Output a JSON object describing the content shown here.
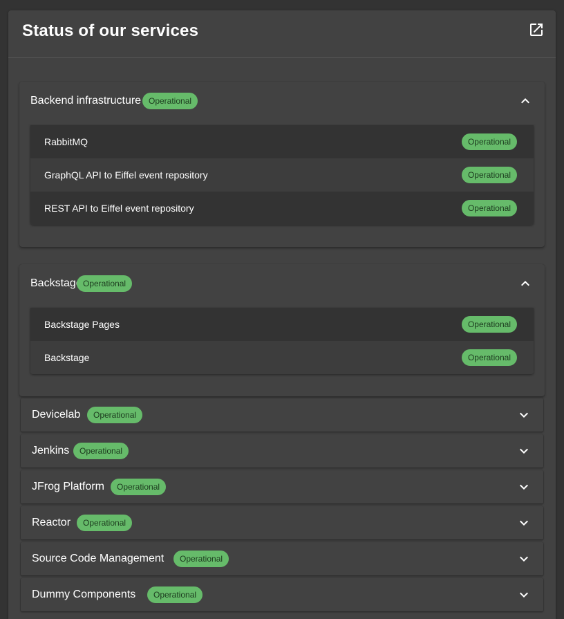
{
  "card": {
    "title": "Status of our services",
    "open_icon": "open-in-new-icon"
  },
  "status_color": "#66bb6a",
  "expanded_groups": [
    {
      "name": "Backend infrastructure",
      "status": "Operational",
      "services": [
        {
          "name": "RabbitMQ",
          "status": "Operational"
        },
        {
          "name": "GraphQL API to Eiffel event repository",
          "status": "Operational"
        },
        {
          "name": "REST API to Eiffel event repository",
          "status": "Operational"
        }
      ]
    },
    {
      "name": "Backstage",
      "status": "Operational",
      "services": [
        {
          "name": "Backstage Pages",
          "status": "Operational"
        },
        {
          "name": "Backstage",
          "status": "Operational"
        }
      ]
    }
  ],
  "collapsed_groups": [
    {
      "name": "Devicelab",
      "status": "Operational"
    },
    {
      "name": "Jenkins",
      "status": "Operational"
    },
    {
      "name": "JFrog Platform",
      "status": "Operational"
    },
    {
      "name": "Reactor",
      "status": "Operational"
    },
    {
      "name": "Source Code Management",
      "status": "Operational"
    },
    {
      "name": "Dummy Components",
      "status": "Operational"
    }
  ]
}
